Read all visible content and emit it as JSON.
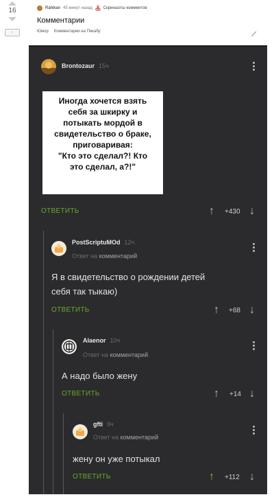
{
  "left": {
    "vote_count": "16",
    "collapse_label": "-"
  },
  "post": {
    "author": "Rahikan",
    "time": "45 минут назад",
    "share_link": "Скриншоты комментов",
    "title": "Комментарии",
    "tags": [
      "Юмор",
      "Комментарии на Пикабу"
    ]
  },
  "comments": [
    {
      "user": "Brontozaur",
      "time": "15ч",
      "meme_lines": [
        "Иногда хочется взять",
        "себя за шкирку и",
        "потыкать мордой в",
        "свидетельство о браке,",
        "приговаривая:",
        "\"Кто это сделал?! Кто",
        "это сделал, а?!\""
      ],
      "reply": "ОТВЕТИТЬ",
      "rating": "+430"
    },
    {
      "user": "PostScriptuMOd",
      "time": "12ч",
      "reply_to_prefix": "Ответ на",
      "reply_to": "комментарий",
      "text_lines": [
        "Я в свидетельство о рождении детей",
        "себя так тыкаю)"
      ],
      "reply": "ОТВЕТИТЬ",
      "rating": "+68"
    },
    {
      "user": "Alaenor",
      "time": "10ч",
      "reply_to_prefix": "Ответ на",
      "reply_to": "комментарий",
      "text": "А надо было жену",
      "reply": "ОТВЕТИТЬ",
      "rating": "+14"
    },
    {
      "user": "gfti",
      "time": "9ч",
      "reply_to_prefix": "Ответ на",
      "reply_to": "комментарий",
      "text": "жену он уже потыкал",
      "reply": "ОТВЕТИТЬ",
      "rating": "+112"
    }
  ],
  "icons": {
    "vote_up": "arrow-up-icon",
    "vote_down": "arrow-down-icon",
    "menu": "more-vertical-icon",
    "edit": "pencil-icon",
    "share": "scissors-icon"
  },
  "colors": {
    "dark_bg": "#2b2b2d",
    "reply": "#6aa82e",
    "upvoted": "#7bc13f"
  }
}
